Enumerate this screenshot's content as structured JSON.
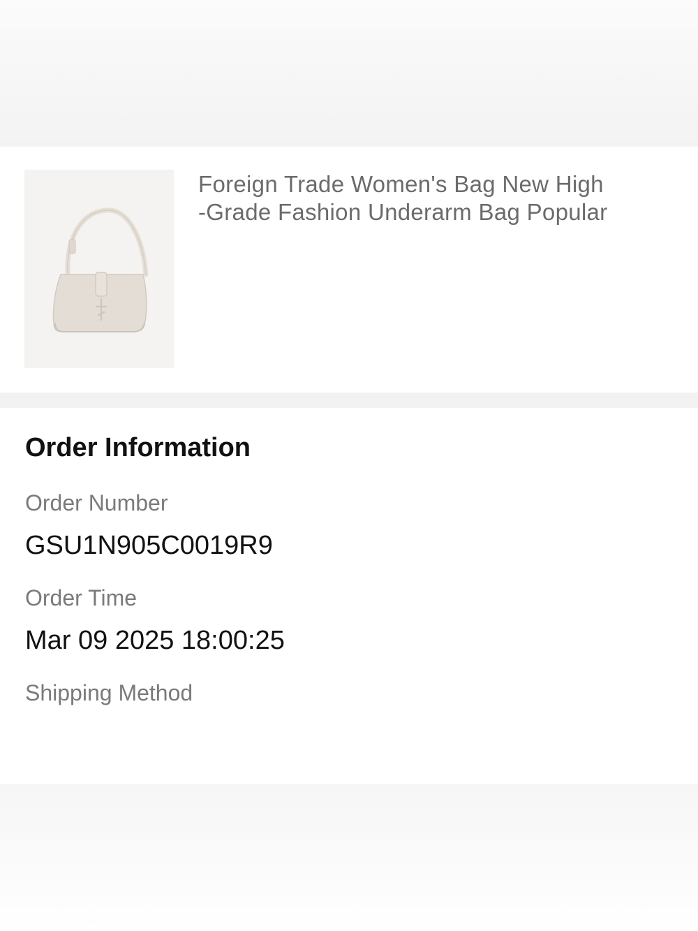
{
  "product": {
    "title": "Foreign Trade Women's Bag New High\n-Grade Fashion Underarm Bag Popular",
    "image_icon": "handbag-image"
  },
  "order_info": {
    "heading": "Order Information",
    "order_number_label": "Order Number",
    "order_number_value": "GSU1N905C0019R9",
    "order_time_label": "Order Time",
    "order_time_value": "Mar 09 2025 18:00:25",
    "shipping_method_label": "Shipping Method"
  },
  "colors": {
    "background": "#ffffff",
    "section_gap": "#f2f2f2",
    "label_gray": "#7a7a7a",
    "value_black": "#111111"
  }
}
